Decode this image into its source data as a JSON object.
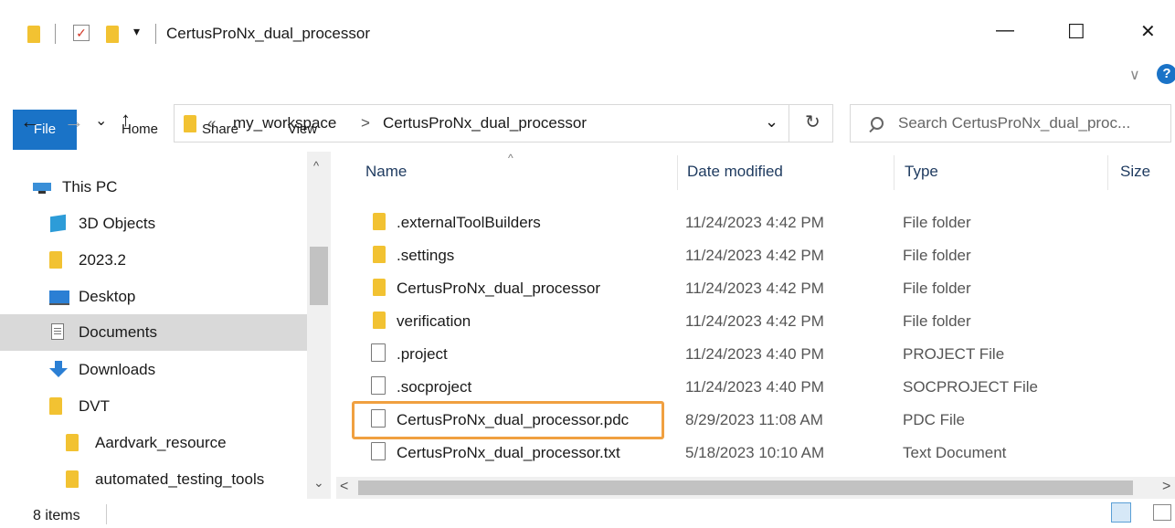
{
  "window": {
    "title": "CertusProNx_dual_processor",
    "minimize": "—",
    "maximize": "☐",
    "close": "✕"
  },
  "ribbon": {
    "tabs": [
      "File",
      "Home",
      "Share",
      "View"
    ],
    "help": "?",
    "expand": "∨"
  },
  "address": {
    "overflow": "«",
    "crumbs": [
      "my_workspace",
      "CertusProNx_dual_processor"
    ],
    "separator": ">",
    "dropdown": "⌄",
    "refresh": "↻",
    "search_placeholder": "Search CertusProNx_dual_proc..."
  },
  "nav": {
    "back": "←",
    "forward": "→",
    "recent": "⌄",
    "up": "↑",
    "items": [
      {
        "label": "This PC",
        "icon": "pc-icon"
      },
      {
        "label": "3D Objects",
        "icon": "cube-icon"
      },
      {
        "label": "2023.2",
        "icon": "folder-icon"
      },
      {
        "label": "Desktop",
        "icon": "desktop-icon"
      },
      {
        "label": "Documents",
        "icon": "documents-icon",
        "selected": true
      },
      {
        "label": "Downloads",
        "icon": "download-icon"
      },
      {
        "label": "DVT",
        "icon": "folder-icon"
      },
      {
        "label": "Aardvark_resource",
        "icon": "folder-icon"
      },
      {
        "label": "automated_testing_tools",
        "icon": "folder-icon"
      }
    ]
  },
  "columns": {
    "name": "Name",
    "date": "Date modified",
    "type": "Type",
    "size": "Size"
  },
  "files": [
    {
      "name": ".externalToolBuilders",
      "date": "11/24/2023 4:42 PM",
      "type": "File folder",
      "kind": "folder"
    },
    {
      "name": ".settings",
      "date": "11/24/2023 4:42 PM",
      "type": "File folder",
      "kind": "folder"
    },
    {
      "name": "CertusProNx_dual_processor",
      "date": "11/24/2023 4:42 PM",
      "type": "File folder",
      "kind": "folder"
    },
    {
      "name": "verification",
      "date": "11/24/2023 4:42 PM",
      "type": "File folder",
      "kind": "folder"
    },
    {
      "name": ".project",
      "date": "11/24/2023 4:40 PM",
      "type": "PROJECT File",
      "kind": "file"
    },
    {
      "name": ".socproject",
      "date": "11/24/2023 4:40 PM",
      "type": "SOCPROJECT File",
      "kind": "file"
    },
    {
      "name": "CertusProNx_dual_processor.pdc",
      "date": "8/29/2023 11:08 AM",
      "type": "PDC File",
      "kind": "file",
      "highlighted": true
    },
    {
      "name": "CertusProNx_dual_processor.txt",
      "date": "5/18/2023 10:10 AM",
      "type": "Text Document",
      "kind": "text"
    }
  ],
  "status": {
    "count": "8 items"
  },
  "colors": {
    "accent": "#1a73c7",
    "highlight": "#f0a040",
    "selected": "#d9d9d9",
    "folder": "#f2c232"
  }
}
